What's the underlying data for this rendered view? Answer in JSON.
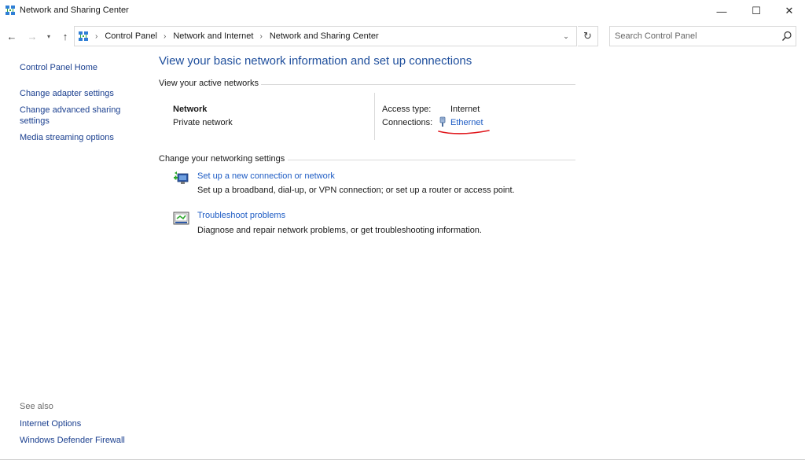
{
  "window": {
    "title": "Network and Sharing Center",
    "minimize_glyph": "—",
    "maximize_glyph": "☐",
    "close_glyph": "✕"
  },
  "nav": {
    "back_glyph": "←",
    "forward_glyph": "→",
    "recent_glyph": "▾",
    "up_glyph": "↑",
    "breadcrumbs": [
      "Control Panel",
      "Network and Internet",
      "Network and Sharing Center"
    ],
    "separator": "›",
    "dropdown_glyph": "⌄",
    "refresh_glyph": "↻",
    "search_placeholder": "Search Control Panel"
  },
  "sidebar": {
    "links": [
      "Control Panel Home",
      "Change adapter settings",
      "Change advanced sharing settings",
      "Media streaming options"
    ],
    "see_also_label": "See also",
    "see_also_links": [
      "Internet Options",
      "Windows Defender Firewall"
    ]
  },
  "main": {
    "title": "View your basic network information and set up connections",
    "active_networks_heading": "View your active networks",
    "network": {
      "name": "Network",
      "category": "Private network",
      "access_type_label": "Access type:",
      "access_type_value": "Internet",
      "connections_label": "Connections:",
      "connection_name": "Ethernet"
    },
    "settings_heading": "Change your networking settings",
    "tasks": [
      {
        "link": "Set up a new connection or network",
        "description": "Set up a broadband, dial-up, or VPN connection; or set up a router or access point."
      },
      {
        "link": "Troubleshoot problems",
        "description": "Diagnose and repair network problems, or get troubleshooting information."
      }
    ]
  },
  "colors": {
    "link": "#1e5cc4",
    "title": "#1e4e9c",
    "annotation": "#e0161b"
  }
}
